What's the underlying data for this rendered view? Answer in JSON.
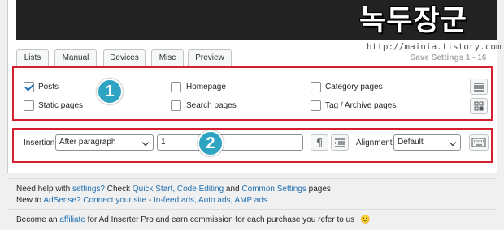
{
  "watermark": {
    "korean_text": "녹두장군",
    "url": "http://mainia.tistory.com"
  },
  "tabs": [
    {
      "label": "Lists"
    },
    {
      "label": "Manual"
    },
    {
      "label": "Devices"
    },
    {
      "label": "Misc"
    },
    {
      "label": "Preview"
    }
  ],
  "save_button": {
    "label": "Save Settings 1 - 16"
  },
  "pages_section": {
    "badge": "1",
    "checkboxes": [
      {
        "label": "Posts",
        "checked": true
      },
      {
        "label": "Static pages",
        "checked": false
      },
      {
        "label": "Homepage",
        "checked": false
      },
      {
        "label": "Search pages",
        "checked": false
      },
      {
        "label": "Category pages",
        "checked": false
      },
      {
        "label": "Tag / Archive pages",
        "checked": false
      }
    ]
  },
  "insertion_section": {
    "badge": "2",
    "insertion_label": "Insertion",
    "insertion_value": "After paragraph",
    "paragraph_number": "1",
    "alignment_label": "Alignment",
    "alignment_value": "Default"
  },
  "footer": {
    "line1": {
      "t1": "Need help with ",
      "l1": "settings?",
      "t2": " Check ",
      "l2": "Quick Start, Code Editing",
      "t3": " and ",
      "l3": "Common Settings",
      "t4": " pages"
    },
    "line2": {
      "t1": "New to ",
      "l1": "AdSense?",
      "t2": " ",
      "l2": "Connect your site",
      "t3": " - ",
      "l3": "In-feed ads, Auto ads, AMP ads"
    },
    "line3": {
      "t1": "Become an ",
      "l1": "affiliate",
      "t2": " for Ad Inserter Pro and earn commission for each purchase you refer to us",
      "emoji": "🙂"
    }
  },
  "colors": {
    "highlight_border": "#d7202f",
    "badge": "#2ea3c2",
    "link": "#2271b1",
    "checkbox_check": "#2271b1"
  }
}
